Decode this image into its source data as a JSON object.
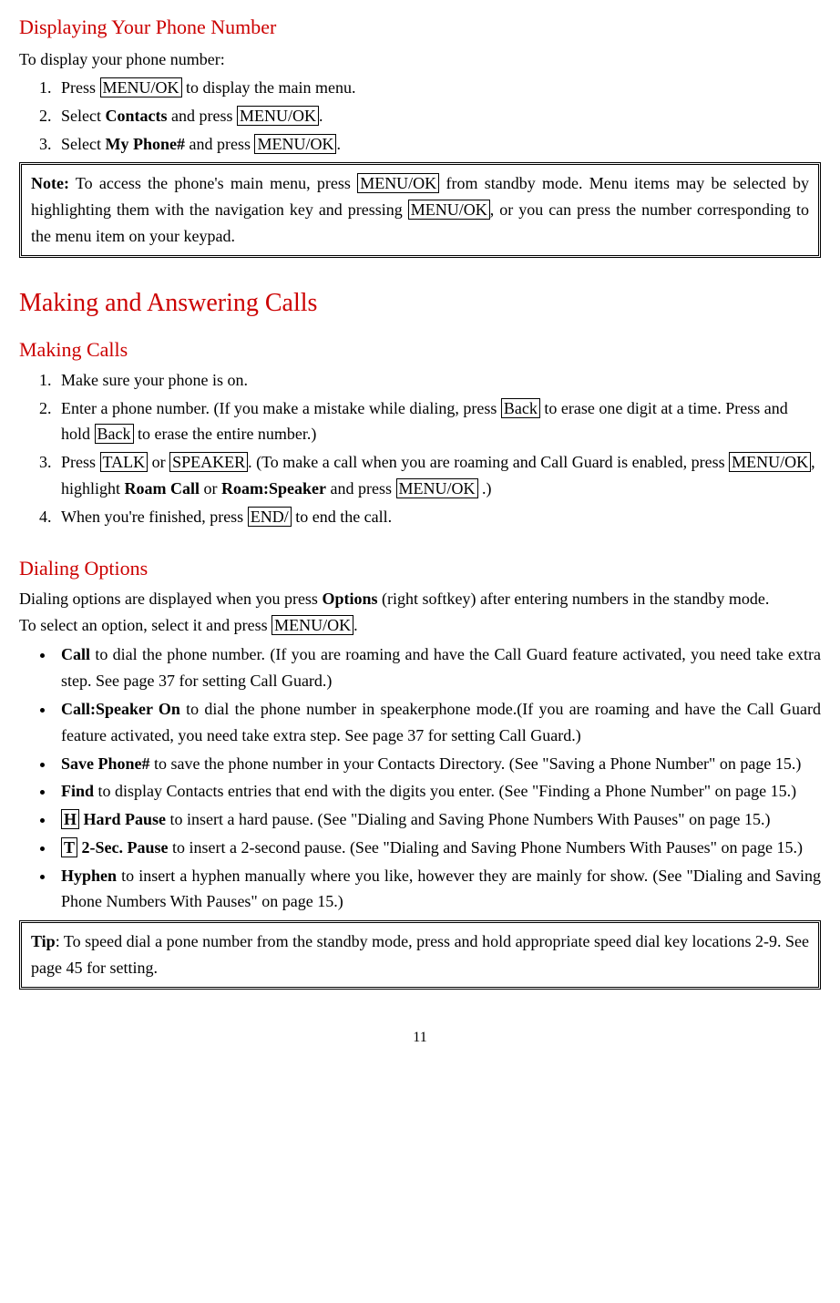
{
  "page_number": "11",
  "s1": {
    "title": "Displaying Your Phone Number",
    "intro": "To display your phone number:",
    "steps": {
      "s1a": "Press ",
      "s1b": "MENU/OK",
      "s1c": " to display the main menu.",
      "s2a": "Select ",
      "s2b": "Contacts",
      "s2c": " and press ",
      "s2d": "MENU/OK",
      "s2e": ".",
      "s3a": "Select ",
      "s3b": "My Phone#",
      "s3c": " and press ",
      "s3d": "MENU/OK",
      "s3e": "."
    },
    "note": {
      "a": "Note:",
      "b": " To access the phone's main menu, press ",
      "c": "MENU/OK",
      "d": " from standby mode. Menu items may be selected by highlighting them with the navigation key and pressing ",
      "e": "MENU/OK",
      "f": ", or you can press the number corresponding to the menu item on your keypad."
    }
  },
  "s2": {
    "title": "Making and Answering Calls",
    "sub1": "Making Calls",
    "steps": {
      "m1": "Make sure your phone is on.",
      "m2a": "Enter a phone number. (If you make a mistake while dialing, press ",
      "m2b": "Back",
      "m2c": " to erase one digit at a time. Press and hold ",
      "m2d": "Back",
      "m2e": " to erase the entire number.)",
      "m3a": "Press ",
      "m3b": "TALK",
      "m3c": " or ",
      "m3d": "SPEAKER",
      "m3e": ". (To make a call when you are roaming and Call Guard is enabled, press ",
      "m3f": "MENU/OK",
      "m3g": ", highlight ",
      "m3h": "Roam Call",
      "m3i": " or ",
      "m3j": "Roam:Speaker",
      "m3k": " and press ",
      "m3l": "MENU/OK",
      "m3m": " .)",
      "m4a": "When you're finished, press ",
      "m4b": "END/",
      "m4c": " to end the call."
    },
    "sub2": "Dialing Options",
    "do_intro1a": "Dialing options are displayed when you press ",
    "do_intro1b": "Options",
    "do_intro1c": " (right softkey) after entering numbers in the standby mode.",
    "do_intro2a": "To select an option, select it and press ",
    "do_intro2b": "MENU/OK",
    "do_intro2c": ".",
    "opts": {
      "o1a": "Call",
      "o1b": " to dial the phone number. (If you are roaming and have the Call Guard feature activated, you need take extra step. See page 37 for setting Call Guard.)",
      "o2a": "Call:Speaker On",
      "o2b": " to dial the phone number in speakerphone mode.(If you are roaming and have the Call Guard feature activated, you need take extra step. See page 37 for setting Call Guard.)",
      "o3a": "Save Phone#",
      "o3b": " to save the phone number in your Contacts Directory. (See \"Saving a Phone Number\" on page 15.)",
      "o4a": "Find",
      "o4b": " to display Contacts entries that end with the digits you enter. (See \"Finding a Phone Number\" on page 15.)",
      "o5a": "H",
      "o5b": " Hard Pause",
      "o5c": " to insert a hard pause. (See \"Dialing and Saving Phone Numbers With Pauses\" on page 15.)",
      "o6a": "T",
      "o6b": " 2-Sec. Pause",
      "o6c": " to insert a 2-second pause. (See \"Dialing and Saving Phone Numbers With Pauses\" on page 15.)",
      "o7a": "Hyphen",
      "o7b": " to insert a hyphen manually where you like, however they are mainly for show. (See \"Dialing and Saving Phone Numbers With Pauses\" on page 15.)"
    },
    "tip": {
      "a": "Tip",
      "b": ": To speed dial a pone number from the standby mode, press and hold appropriate speed dial key locations 2-9. See page 45 for setting."
    }
  }
}
